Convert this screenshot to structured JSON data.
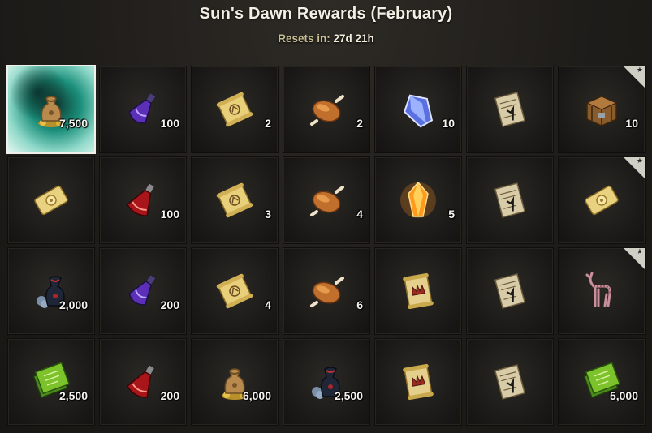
{
  "header": {
    "title": "Sun's Dawn Rewards (February)",
    "resets_label": "Resets in:",
    "resets_value": "27d 21h"
  },
  "rows": [
    [
      {
        "icon": "gold-sack-icon",
        "qty": "7,500",
        "selected": true,
        "featured": false
      },
      {
        "icon": "purple-potion-icon",
        "qty": "100",
        "selected": false,
        "featured": false
      },
      {
        "icon": "golden-scroll-icon",
        "qty": "2",
        "selected": false,
        "featured": false
      },
      {
        "icon": "roast-food-icon",
        "qty": "2",
        "selected": false,
        "featured": false
      },
      {
        "icon": "blue-crystal-icon",
        "qty": "10",
        "selected": false,
        "featured": false
      },
      {
        "icon": "parchment-scroll-icon",
        "qty": "",
        "selected": false,
        "featured": false
      },
      {
        "icon": "wooden-crate-icon",
        "qty": "10",
        "selected": false,
        "featured": true
      }
    ],
    [
      {
        "icon": "golden-ticket-icon",
        "qty": "",
        "selected": false,
        "featured": false
      },
      {
        "icon": "red-potion-icon",
        "qty": "100",
        "selected": false,
        "featured": false
      },
      {
        "icon": "golden-scroll-icon",
        "qty": "3",
        "selected": false,
        "featured": false
      },
      {
        "icon": "roast-food-icon",
        "qty": "4",
        "selected": false,
        "featured": false
      },
      {
        "icon": "orange-crystal-icon",
        "qty": "5",
        "selected": false,
        "featured": false
      },
      {
        "icon": "parchment-scroll-icon",
        "qty": "",
        "selected": false,
        "featured": false
      },
      {
        "icon": "golden-ticket-icon",
        "qty": "",
        "selected": false,
        "featured": true
      }
    ],
    [
      {
        "icon": "blue-pouch-icon",
        "qty": "2,000",
        "selected": false,
        "featured": false
      },
      {
        "icon": "purple-potion-icon",
        "qty": "200",
        "selected": false,
        "featured": false
      },
      {
        "icon": "golden-scroll-icon",
        "qty": "4",
        "selected": false,
        "featured": false
      },
      {
        "icon": "roast-food-icon",
        "qty": "6",
        "selected": false,
        "featured": false
      },
      {
        "icon": "crown-scroll-icon",
        "qty": "",
        "selected": false,
        "featured": false
      },
      {
        "icon": "parchment-scroll-icon",
        "qty": "",
        "selected": false,
        "featured": false
      },
      {
        "icon": "deer-figure-icon",
        "qty": "",
        "selected": false,
        "featured": true
      }
    ],
    [
      {
        "icon": "green-tome-icon",
        "qty": "2,500",
        "selected": false,
        "featured": false
      },
      {
        "icon": "red-potion-icon",
        "qty": "200",
        "selected": false,
        "featured": false
      },
      {
        "icon": "gold-sack-icon",
        "qty": "6,000",
        "selected": false,
        "featured": false
      },
      {
        "icon": "blue-pouch-icon",
        "qty": "2,500",
        "selected": false,
        "featured": false
      },
      {
        "icon": "crown-scroll-icon",
        "qty": "",
        "selected": false,
        "featured": false
      },
      {
        "icon": "parchment-scroll-icon",
        "qty": "",
        "selected": false,
        "featured": false
      },
      {
        "icon": "green-tome-icon",
        "qty": "5,000",
        "selected": false,
        "featured": false
      }
    ]
  ]
}
